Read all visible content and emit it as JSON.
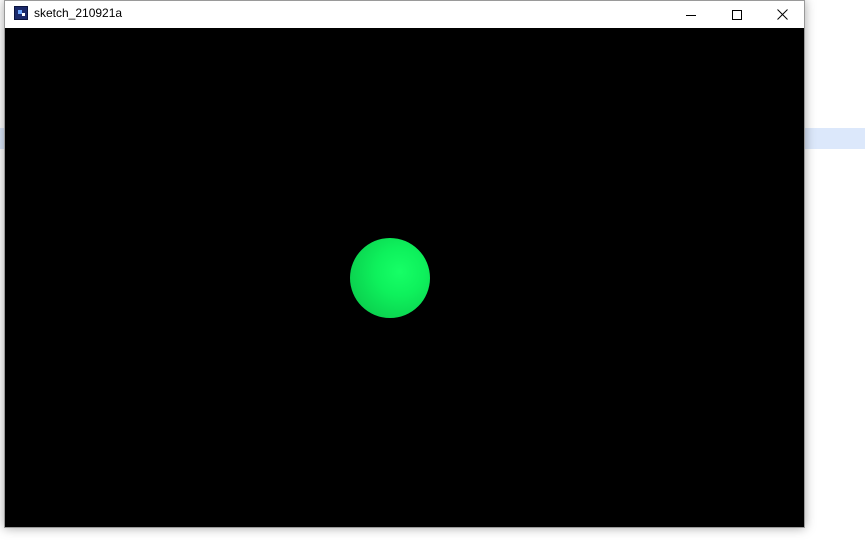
{
  "window": {
    "title": "sketch_210921a",
    "icon": "processing-app-icon",
    "controls": {
      "minimize_icon": "minimize-icon",
      "maximize_icon": "maximize-icon",
      "close_icon": "close-icon"
    }
  },
  "canvas": {
    "background_color": "#000000",
    "sphere_color": "#10f05c"
  },
  "backdrop": {
    "highlight_color": "#dce8fb"
  }
}
